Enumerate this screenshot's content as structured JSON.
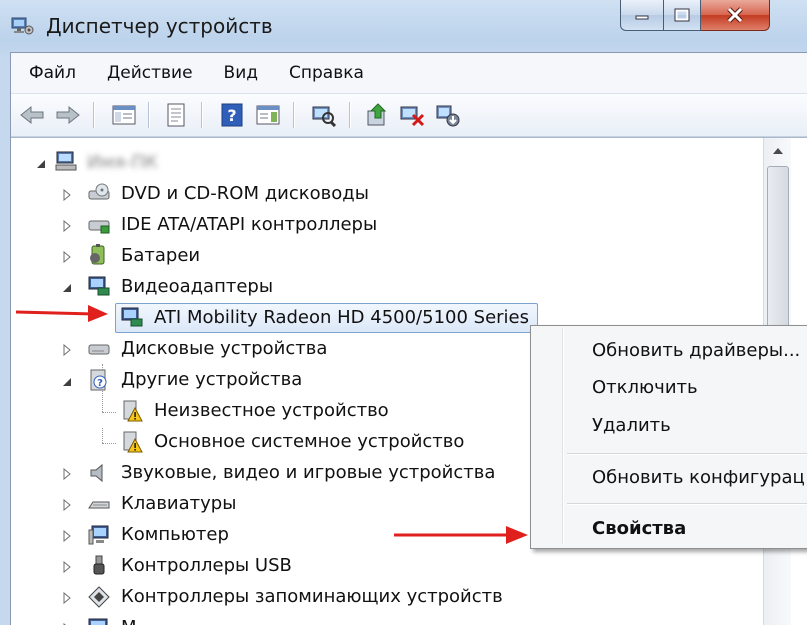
{
  "window": {
    "title": "Диспетчер устройств",
    "caption_buttons": [
      "minimize",
      "maximize",
      "close"
    ]
  },
  "menubar": {
    "items": [
      "Файл",
      "Действие",
      "Вид",
      "Справка"
    ]
  },
  "toolbar": {
    "icons": [
      "back-icon",
      "forward-icon",
      "show-hide-tree-icon",
      "properties-icon",
      "help-icon",
      "view-icon",
      "scan-hardware-icon",
      "update-driver-icon",
      "disable-device-icon",
      "uninstall-device-icon"
    ]
  },
  "tree": {
    "root": "Имя-ПК",
    "nodes": [
      {
        "label": "DVD и CD-ROM дисководы",
        "expanded": false,
        "icon": "dvd-drive-icon"
      },
      {
        "label": "IDE ATA/ATAPI контроллеры",
        "expanded": false,
        "icon": "ide-controller-icon"
      },
      {
        "label": "Батареи",
        "expanded": false,
        "icon": "battery-icon"
      },
      {
        "label": "Видеоадаптеры",
        "expanded": true,
        "icon": "display-adapter-icon"
      },
      {
        "label": "ATI Mobility Radeon HD 4500/5100 Series",
        "child": true,
        "selected": true,
        "icon": "display-adapter-icon"
      },
      {
        "label": "Дисковые устройства",
        "expanded": false,
        "icon": "disk-drive-icon"
      },
      {
        "label": "Другие устройства",
        "expanded": true,
        "icon": "unknown-device-icon"
      },
      {
        "label": "Неизвестное устройство",
        "child": true,
        "icon": "warning-device-icon"
      },
      {
        "label": "Основное системное устройство",
        "child": true,
        "icon": "warning-device-icon"
      },
      {
        "label": "Звуковые, видео и игровые устройства",
        "expanded": false,
        "icon": "speaker-icon"
      },
      {
        "label": "Клавиатуры",
        "expanded": false,
        "icon": "keyboard-icon"
      },
      {
        "label": "Компьютер",
        "expanded": false,
        "icon": "computer-icon"
      },
      {
        "label": "Контроллеры USB",
        "expanded": false,
        "icon": "usb-icon"
      },
      {
        "label": "Контроллеры запоминающих устройств",
        "expanded": false,
        "icon": "storage-controller-icon"
      },
      {
        "label": "М...",
        "expanded": false,
        "icon": "monitor-icon"
      }
    ]
  },
  "context_menu": {
    "items": [
      {
        "label": "Обновить драйверы...",
        "bold": false
      },
      {
        "label": "Отключить",
        "bold": false
      },
      {
        "label": "Удалить",
        "bold": false
      },
      {
        "label": "Обновить конфигурац",
        "bold": false
      },
      {
        "label": "Свойства",
        "bold": true
      }
    ]
  },
  "colors": {
    "accent_red_arrow": "#e0201c",
    "selection_border": "#7da2ce",
    "titlebar": "#c5d8ee"
  }
}
